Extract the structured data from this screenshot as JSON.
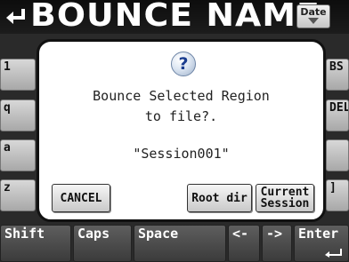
{
  "header": {
    "title": "BOUNCE NAME",
    "date_button": "Date",
    "back_icon": "return-arrow-icon"
  },
  "keyboard": {
    "row_keys": [
      "1",
      "q",
      "a",
      "z"
    ],
    "right_keys": [
      "BS",
      "DEL",
      "",
      "]"
    ],
    "bottom_keys": [
      "Shift",
      "Caps",
      "Space",
      "<-",
      "->",
      "Enter"
    ]
  },
  "dialog": {
    "icon": "question-icon",
    "message_line1": "Bounce Selected Region",
    "message_line2": "to file?.",
    "file_name": "\"Session001\"",
    "buttons": {
      "cancel": "CANCEL",
      "root_dir": "Root dir",
      "current_session_line1": "Current",
      "current_session_line2": "Session"
    }
  },
  "colors": {
    "background": "#111111",
    "dialog_background": "#ffffff",
    "key_face": "#c8c8c8",
    "help_icon_blue": "#1a3d8f"
  }
}
